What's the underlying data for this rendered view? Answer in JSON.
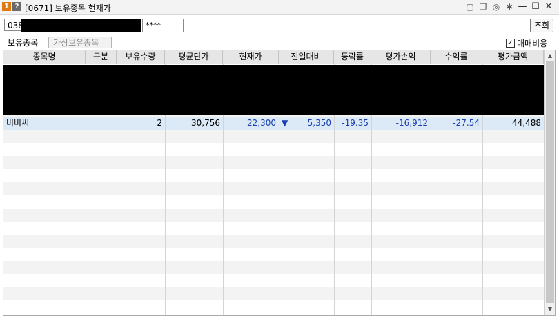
{
  "window": {
    "badge_num": "1",
    "badge_help": "?",
    "title": "[0671] 보유종목 현재가",
    "icons": [
      "notepad-icon",
      "window-copy-icon",
      "camera-icon",
      "gear-icon",
      "minimize-icon",
      "maximize-icon",
      "close-icon"
    ],
    "icon_glyphs": [
      "▢",
      "❐",
      "◎",
      "✱",
      "—",
      "☐",
      "✕"
    ]
  },
  "account": {
    "number_visible": "038",
    "password_mask": "****",
    "search_label": "조회"
  },
  "tabs": [
    {
      "label": "보유종목",
      "active": true
    },
    {
      "label": "가상보유종목",
      "active": false
    }
  ],
  "fee_option": {
    "label": "매매비용",
    "checked": true,
    "check_glyph": "✓"
  },
  "table": {
    "headers": [
      "종목명",
      "구분",
      "보유수량",
      "평균단가",
      "현재가",
      "전일대비",
      "등락률",
      "평가손익",
      "수익률",
      "평가금액"
    ],
    "rows": [
      {
        "name": "비비씨",
        "type": "",
        "qty": "2",
        "avg_price": "30,756",
        "cur_price": "22,300",
        "change_sign": "▼",
        "change": "5,350",
        "rate": "-19.35",
        "pnl": "-16,912",
        "return_rate": "-27.54",
        "value": "44,488"
      }
    ]
  },
  "colors": {
    "down": "#1a3fb0",
    "selected_row": "#dce9f7",
    "header_bg": "#e6e6e6"
  }
}
